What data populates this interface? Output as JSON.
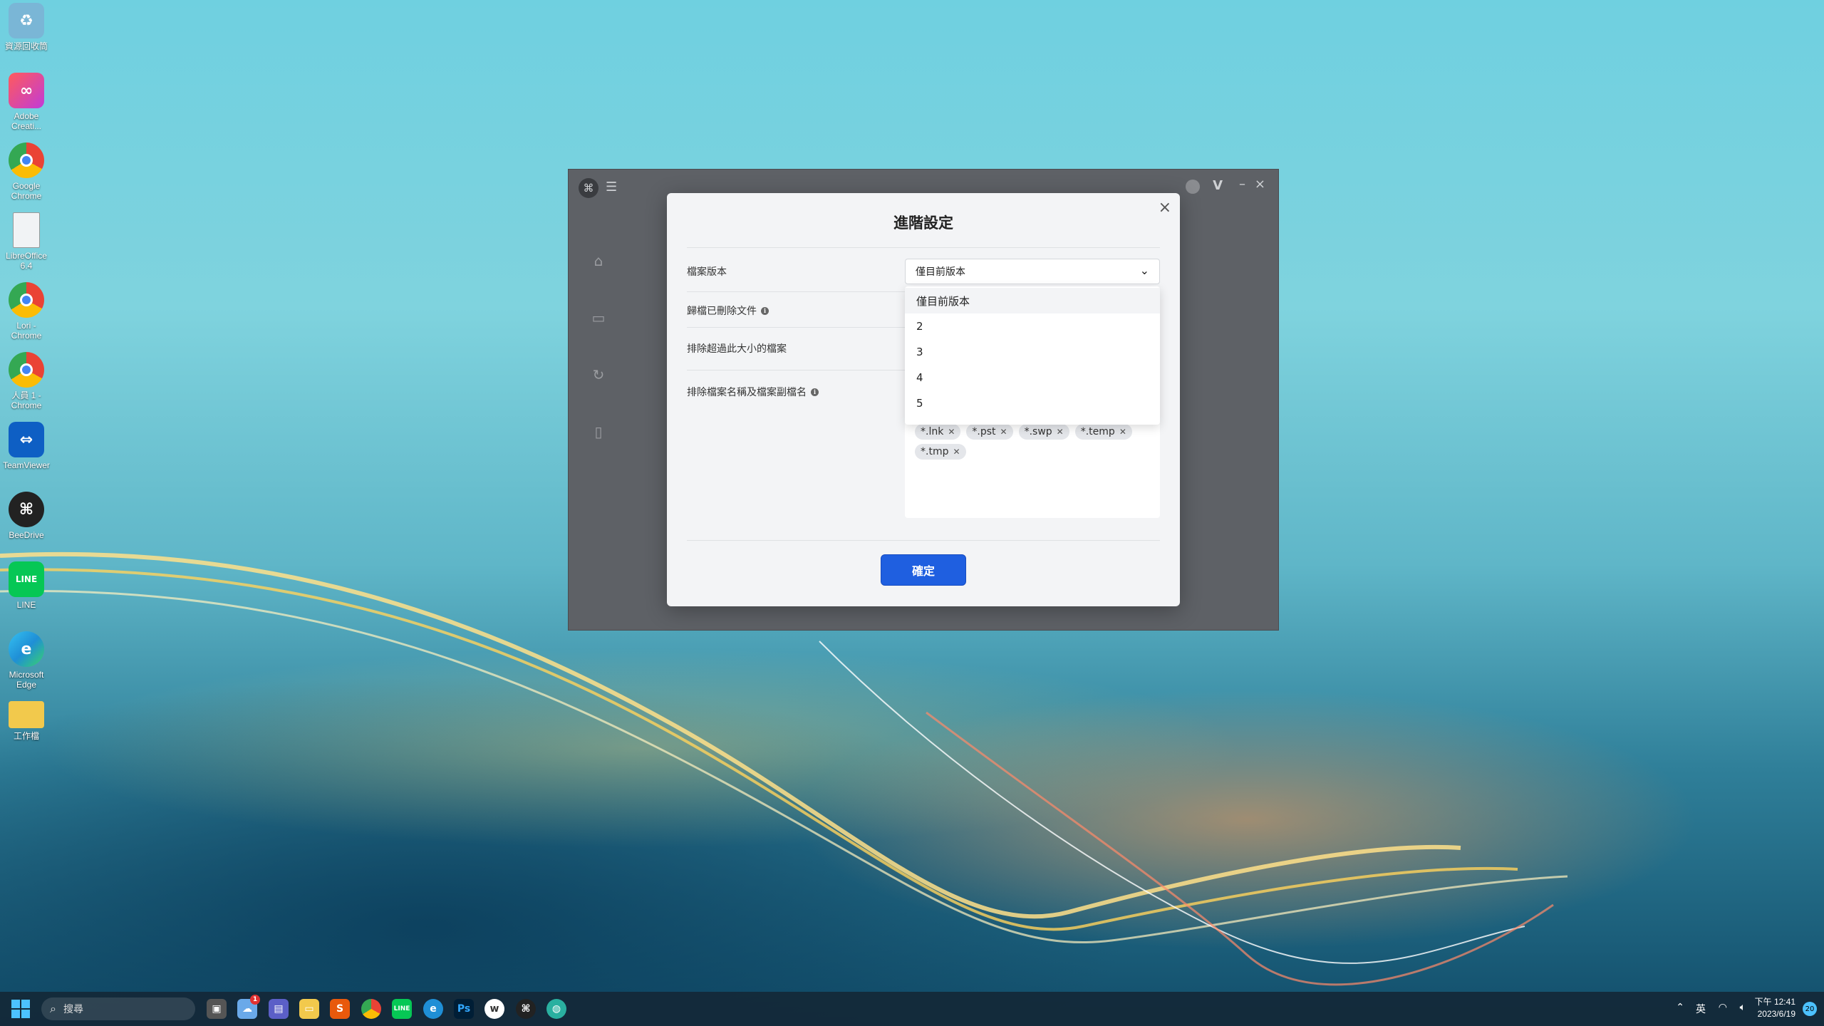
{
  "desktop": {
    "icons": [
      {
        "label": "資源回收筒",
        "icon": "recycle-bin-icon",
        "color": "#7ab6d6"
      },
      {
        "label": "Adobe Creati...",
        "icon": "adobe-cc-icon",
        "color": "#e0356b"
      },
      {
        "label": "Google Chrome",
        "icon": "chrome-icon",
        "color": "#2f9e44"
      },
      {
        "label": "LibreOffice 6.4",
        "icon": "file-icon",
        "color": "#e9ecef"
      },
      {
        "label": "Lori - Chrome",
        "icon": "chrome-profile-icon",
        "color": "#2f9e44"
      },
      {
        "label": "人員 1 - Chrome",
        "icon": "chrome-profile-icon",
        "color": "#2f9e44"
      },
      {
        "label": "TeamViewer",
        "icon": "teamviewer-icon",
        "color": "#0e5fc4"
      },
      {
        "label": "BeeDrive",
        "icon": "beedrive-icon",
        "color": "#222222"
      },
      {
        "label": "LINE",
        "icon": "line-icon",
        "color": "#06c755"
      },
      {
        "label": "Microsoft Edge",
        "icon": "edge-icon",
        "color": "#1f8fd6"
      },
      {
        "label": "工作檔",
        "icon": "folder-icon",
        "color": "#f2c94c"
      }
    ]
  },
  "app": {
    "menu_icon": "hamburger-icon",
    "v_label": "V"
  },
  "modal": {
    "title": "進階設定",
    "close": "×",
    "rows": {
      "file_version": "檔案版本",
      "archive_deleted": "歸檔已刪除文件",
      "exclude_size": "排除超過此大小的檔案",
      "exclude_names": "排除檔案名稱及檔案副檔名"
    },
    "select_value": "僅目前版本",
    "dropdown_options": [
      "僅目前版本",
      "2",
      "3",
      "4",
      "5"
    ],
    "tags": [
      "*.lnk",
      "*.pst",
      "*.swp",
      "*.temp",
      "*.tmp"
    ],
    "confirm_label": "確定"
  },
  "taskbar": {
    "search_placeholder": "搜尋",
    "badge_count": "1",
    "tray_lang": "英",
    "time": "下午 12:41",
    "date": "2023/6/19",
    "notifications": "20"
  },
  "colors": {
    "primary_button": "#1f5fe0",
    "windows_blue": "#4cc2ff"
  }
}
